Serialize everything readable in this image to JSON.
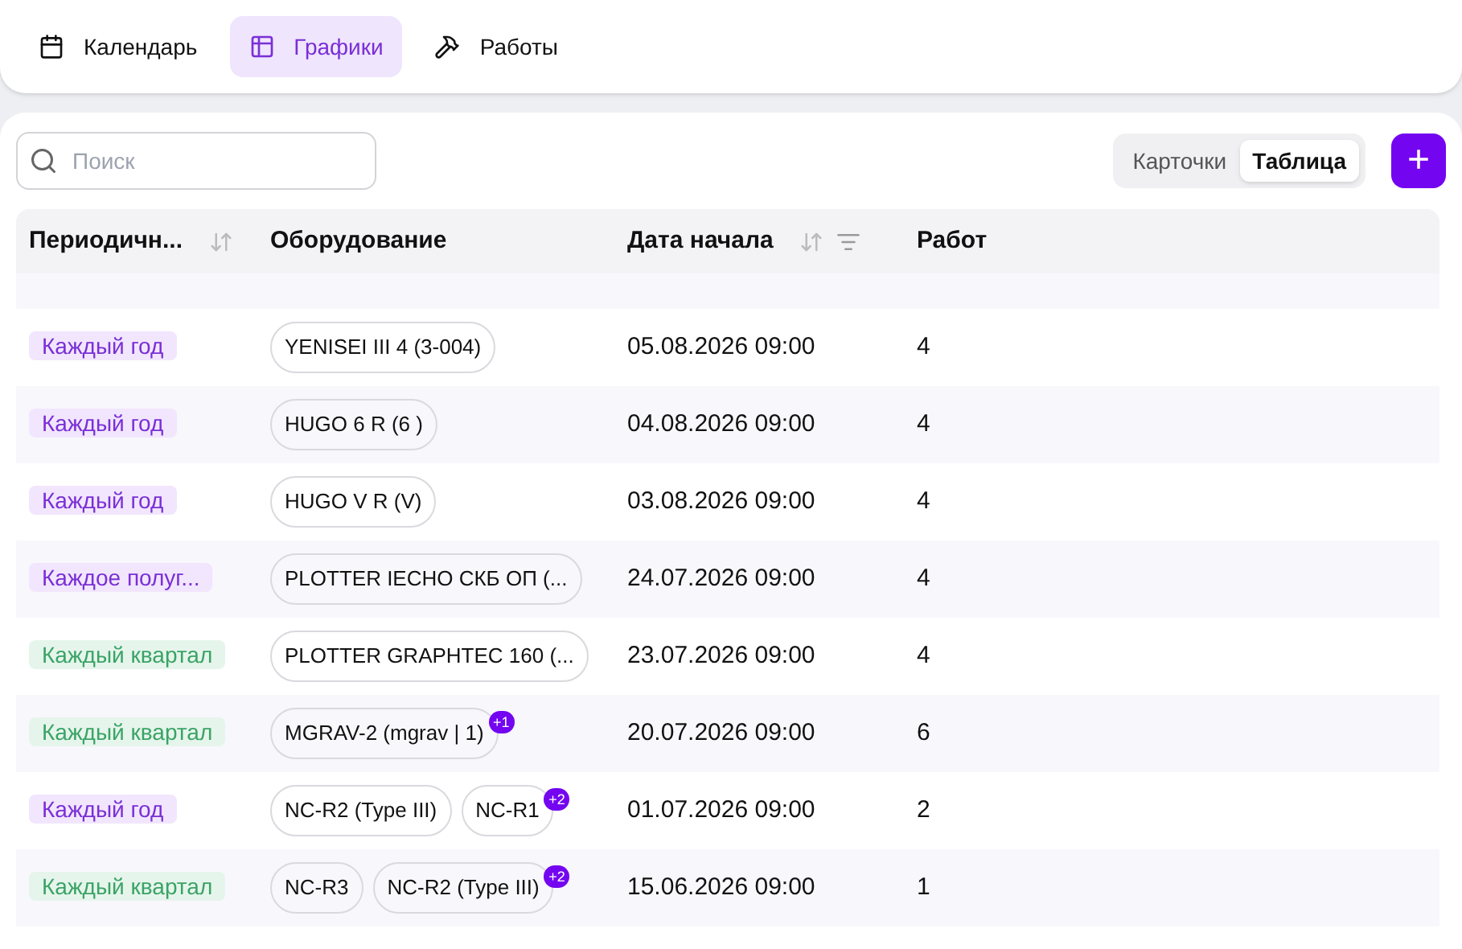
{
  "nav_tabs": [
    {
      "label": "Календарь",
      "selected": false
    },
    {
      "label": "Графики",
      "selected": true
    },
    {
      "label": "Работы",
      "selected": false
    }
  ],
  "search": {
    "placeholder": "Поиск"
  },
  "view_toggle": [
    {
      "label": "Карточки",
      "selected": false
    },
    {
      "label": "Таблица",
      "selected": true
    }
  ],
  "add_button": "+",
  "table": {
    "columns": [
      {
        "label": "Периодичн...",
        "sortable": true,
        "filterable": false
      },
      {
        "label": "Оборудование",
        "sortable": false,
        "filterable": false
      },
      {
        "label": "Дата начала",
        "sortable": true,
        "filterable": true
      },
      {
        "label": "Работ",
        "sortable": false,
        "filterable": false
      }
    ],
    "rows": [
      {
        "period": {
          "label": "Каждый год",
          "kind": "purple"
        },
        "equipment": [
          {
            "label": "YENISEI III 4 (3-004)"
          }
        ],
        "start": "05.08.2026 09:00",
        "count": "4"
      },
      {
        "period": {
          "label": "Каждый год",
          "kind": "purple"
        },
        "equipment": [
          {
            "label": "HUGO 6 R (6 )"
          }
        ],
        "start": "04.08.2026 09:00",
        "count": "4"
      },
      {
        "period": {
          "label": "Каждый год",
          "kind": "purple"
        },
        "equipment": [
          {
            "label": "HUGO V R (V)"
          }
        ],
        "start": "03.08.2026 09:00",
        "count": "4"
      },
      {
        "period": {
          "label": "Каждое полуг...",
          "kind": "purple"
        },
        "equipment": [
          {
            "label": "PLOTTER IECHO СКБ ОП (..."
          }
        ],
        "start": "24.07.2026 09:00",
        "count": "4"
      },
      {
        "period": {
          "label": "Каждый квартал",
          "kind": "green"
        },
        "equipment": [
          {
            "label": "PLOTTER GRAPHTEC 160 (..."
          }
        ],
        "start": "23.07.2026 09:00",
        "count": "4"
      },
      {
        "period": {
          "label": "Каждый квартал",
          "kind": "green"
        },
        "equipment": [
          {
            "label": "MGRAV-2 (mgrav | 1)",
            "more": "+1"
          }
        ],
        "start": "20.07.2026 09:00",
        "count": "6"
      },
      {
        "period": {
          "label": "Каждый год",
          "kind": "purple"
        },
        "equipment": [
          {
            "label": "NC-R2 (Type III)"
          },
          {
            "label": "NC-R1",
            "more": "+2"
          }
        ],
        "start": "01.07.2026 09:00",
        "count": "2"
      },
      {
        "period": {
          "label": "Каждый квартал",
          "kind": "green"
        },
        "equipment": [
          {
            "label": "NC-R3"
          },
          {
            "label": "NC-R2 (Type III)",
            "more": "+2"
          }
        ],
        "start": "15.06.2026 09:00",
        "count": "1"
      }
    ]
  }
}
